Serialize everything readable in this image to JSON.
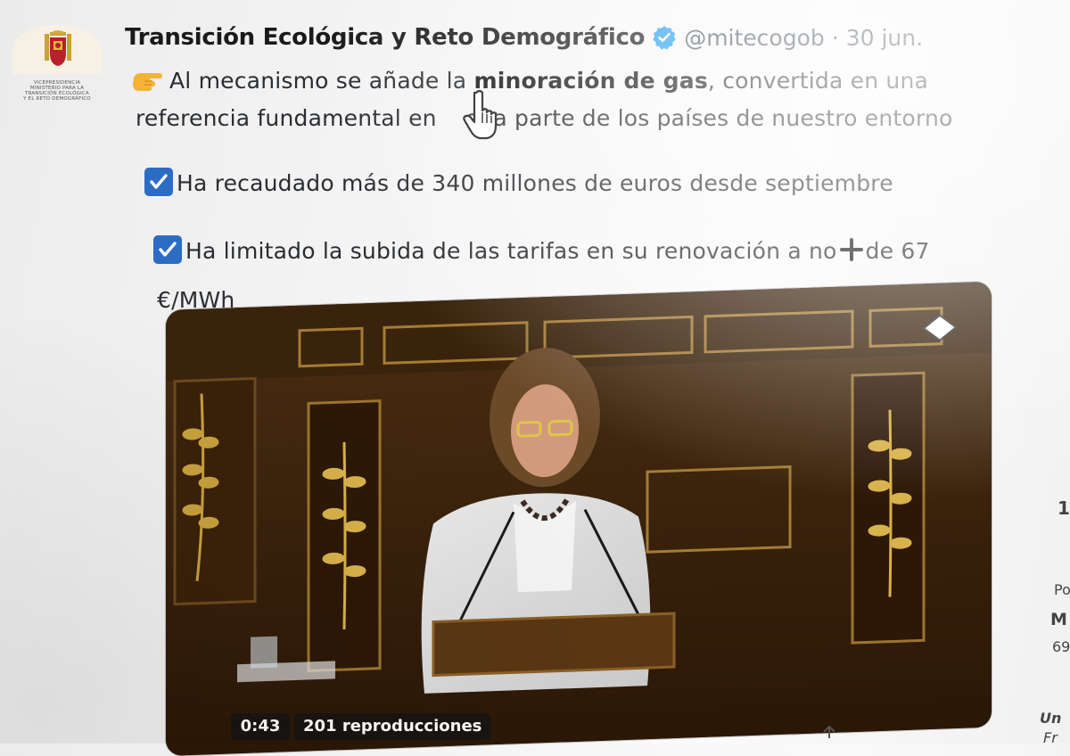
{
  "account": {
    "display_name": "Transición Ecológica y Reto Demográfico",
    "handle": "@mitecogob",
    "separator": "·",
    "date": "30 jun.",
    "avatar_caption": "VICEPRESIDENCIA MINISTERIO PARA LA TRANSICIÓN ECOLÓGICA Y EL RETO DEMOGRÁFICO"
  },
  "tweet": {
    "line1_pre": "Al mecanismo se añade la ",
    "line1_bold": "minoración de gas",
    "line1_post": ", convertida en una",
    "line2": "referencia fundamental en",
    "line2_post": "ena parte de los países de nuestro entorno",
    "bullet1": "Ha recaudado más de 340 millones de euros desde septiembre",
    "bullet2_pre": "Ha limitado la subida de las tarifas en su renovación a no",
    "bullet2_post": "de 67",
    "bullet2_end": "€/MWh"
  },
  "video": {
    "duration": "0:43",
    "views": "201 reproducciones"
  },
  "sidebar_fragments": {
    "a": "1",
    "b": "Po",
    "c": "M",
    "d": "69",
    "e": "Un",
    "f": "Fr"
  },
  "colors": {
    "verified": "#1d9bf0",
    "check_box": "#2b6cc4",
    "video_wood": "#3b2410"
  },
  "icons": [
    "verified-badge-icon",
    "pointing-hand-icon",
    "check-box-icon",
    "plus-icon",
    "hand-cursor-icon",
    "share-icon"
  ]
}
